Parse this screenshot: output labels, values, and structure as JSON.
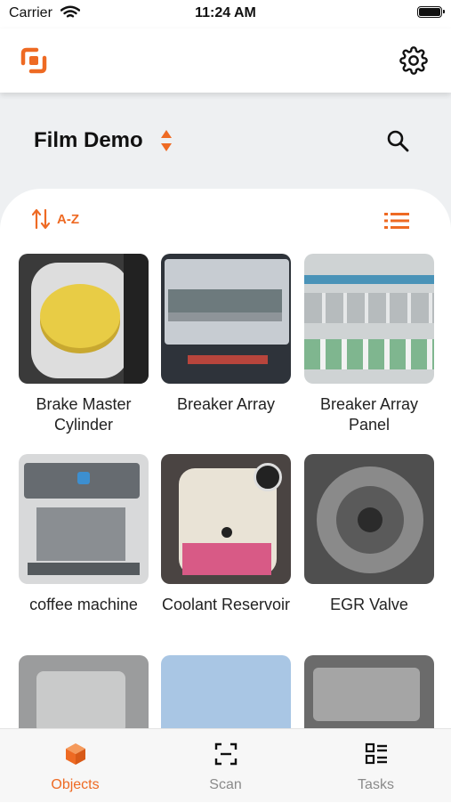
{
  "status_bar": {
    "carrier": "Carrier",
    "time": "11:24 AM"
  },
  "header": {
    "title": "Film Demo"
  },
  "sort": {
    "label": "A-Z"
  },
  "items": [
    {
      "label": "Brake Master Cylinder"
    },
    {
      "label": "Breaker Array"
    },
    {
      "label": "Breaker Array Panel"
    },
    {
      "label": "coffee machine"
    },
    {
      "label": "Coolant Reservoir"
    },
    {
      "label": "EGR Valve"
    },
    {
      "label": ""
    },
    {
      "label": ""
    },
    {
      "label": ""
    }
  ],
  "tabs": [
    {
      "label": "Objects",
      "active": true
    },
    {
      "label": "Scan",
      "active": false
    },
    {
      "label": "Tasks",
      "active": false
    }
  ],
  "colors": {
    "accent": "#ee6a23",
    "inactive": "#8a8a8a",
    "background": "#eef0f2"
  },
  "icons": [
    "wifi-icon",
    "battery-icon",
    "app-logo-icon",
    "gear-icon",
    "sort-arrows-icon",
    "search-icon",
    "sort-az-icon",
    "list-view-icon",
    "cube-icon",
    "scan-icon",
    "tasks-icon"
  ]
}
